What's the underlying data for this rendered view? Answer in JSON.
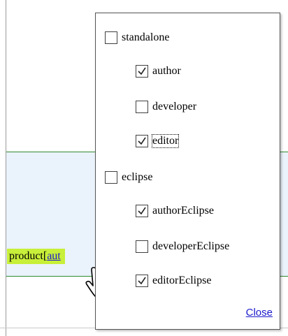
{
  "background": {
    "product_prefix": "product",
    "product_bracket": "[",
    "product_selected": "aut"
  },
  "popup": {
    "groups": [
      {
        "label": "standalone",
        "checked": false,
        "items": [
          {
            "label": "author",
            "checked": true
          },
          {
            "label": "developer",
            "checked": false
          },
          {
            "label": "editor",
            "checked": true,
            "focused": true
          }
        ]
      },
      {
        "label": "eclipse",
        "checked": false,
        "items": [
          {
            "label": "authorEclipse",
            "checked": true
          },
          {
            "label": "developerEclipse",
            "checked": false
          },
          {
            "label": "editorEclipse",
            "checked": true
          }
        ]
      }
    ],
    "close_label": "Close"
  },
  "colors": {
    "highlight": "#c8ef39",
    "link": "#1a1acc",
    "divider": "#2f8a2f",
    "band": "#eaf2fb"
  }
}
